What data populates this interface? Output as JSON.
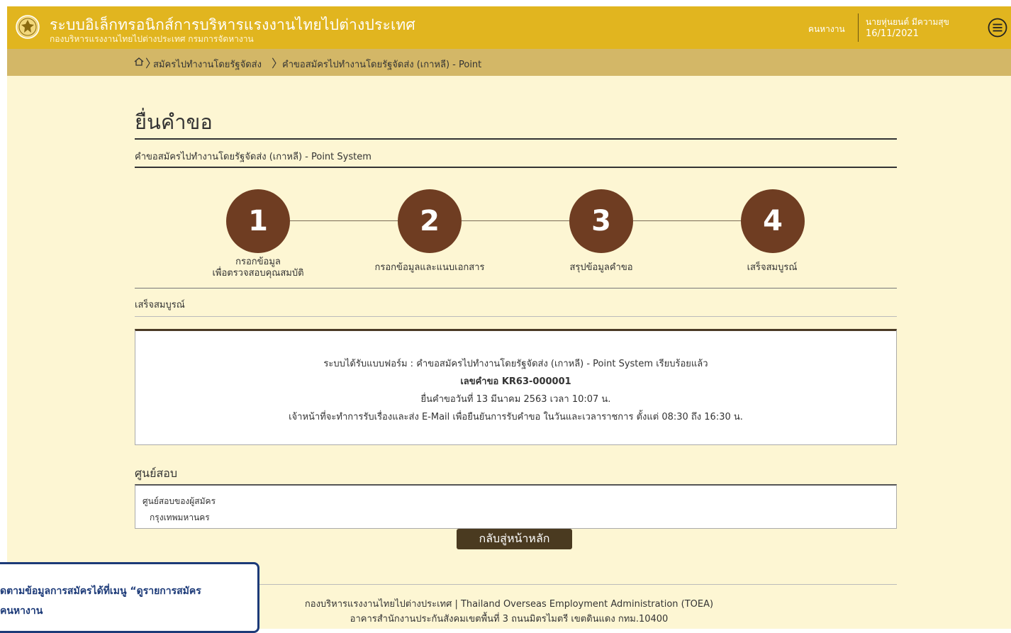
{
  "header": {
    "title": "ระบบอิเล็กทรอนิกส์การบริหารแรงงานไทยไปต่างประเทศ",
    "subtitle": "กองบริหารแรงงานไทยไปต่างประเทศ กรมการจัดหางาน",
    "role": "คนหางาน",
    "user_name": "นายหุ่นยนต์ มีความสุข",
    "user_date": "16/11/2021"
  },
  "breadcrumb": {
    "items": [
      "สมัครไปทำงานโดยรัฐจัดส่ง",
      "คำขอสมัครไปทำงานโดยรัฐจัดส่ง (เกาหลี) - Point"
    ]
  },
  "page": {
    "title": "ยื่นคำขอ",
    "form_name": "คำขอสมัครไปทำงานโดยรัฐจัดส่ง (เกาหลี) - Point System"
  },
  "steps": [
    {
      "number": "1",
      "label_line1": "กรอกข้อมูล",
      "label_line2": "เพื่อตรวจสอบคุณสมบัติ"
    },
    {
      "number": "2",
      "label_line1": "กรอกข้อมูลและแนบเอกสาร",
      "label_line2": ""
    },
    {
      "number": "3",
      "label_line1": "สรุปข้อมูลคำขอ",
      "label_line2": ""
    },
    {
      "number": "4",
      "label_line1": "เสร็จสมบูรณ์",
      "label_line2": ""
    }
  ],
  "status": {
    "text": "เสร็จสมบูรณ์"
  },
  "result": {
    "line1": "ระบบได้รับแบบฟอร์ม : คำขอสมัครไปทำงานโดยรัฐจัดส่ง (เกาหลี) - Point System เรียบร้อยแล้ว",
    "line2": "เลขคำขอ KR63-000001",
    "line3": "ยื่นคำขอวันที่ 13 มีนาคม 2563 เวลา 10:07 น.",
    "line4": "เจ้าหน้าที่จะทำการรับเรื่องและส่ง E-Mail เพื่อยืนยันการรับคำขอ ในวันและเวลาราชการ ตั้งแต่ 08:30 ถึง 16:30 น."
  },
  "exam_center": {
    "heading": "ศูนย์สอบ",
    "label": "ศูนย์สอบของผู้สมัคร",
    "value": "กรุงเทพมหานคร"
  },
  "back_button": {
    "label": "กลับสู่หน้าหลัก"
  },
  "footer": {
    "line1": "กองบริหารแรงงานไทยไปต่างประเทศ | Thailand Overseas Employment Administration (TOEA)",
    "line2": "อาคารสำนักงานประกันสังคมเขตพื้นที่ 3 ถนนมิตรไมตรี เขตดินแดง กทม.10400"
  },
  "tooltip": {
    "line1": "ดตามข้อมูลการสมัครได้ที่เมนู “ดูรายการสมัคร",
    "line2": "คนหางาน"
  },
  "colors": {
    "header_bg": "#e1b51f",
    "breadcrumb_bg": "#d3b767",
    "page_bg": "#fdf6d3",
    "step_circle": "#6f3d22",
    "button_bg": "#4a3a20",
    "tooltip_border": "#1c3a78"
  },
  "icons": {
    "logo": "government-seal-icon",
    "menu": "hamburger-menu-icon",
    "home": "home-icon"
  }
}
